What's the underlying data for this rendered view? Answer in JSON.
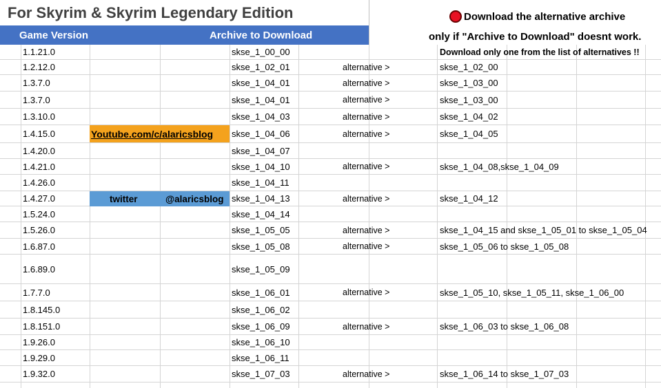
{
  "title": "For Skyrim & Skyrim Legendary Edition",
  "header": {
    "game_version": "Game Version",
    "archive": "Archive to Download"
  },
  "notes": {
    "line1": "Download the alternative archive",
    "line2": "only if \"Archive to Download\" doesnt work.",
    "line3": "Download only one from the list of alternatives !!",
    "stop_icon": "stop-sign-icon",
    "stop_color": "#e81123"
  },
  "links": {
    "youtube": "Youtube.com/c/alaricsblog",
    "twitter_label": "twitter",
    "twitter_handle": "@alaricsblog"
  },
  "colors": {
    "header": "#4472c4",
    "youtube": "#f4a21d",
    "twitter": "#5b9bd5"
  },
  "rows": [
    {
      "version": "1.1.21.0",
      "archive": "skse_1_00_00",
      "alt": "",
      "alternatives": ""
    },
    {
      "version": "1.2.12.0",
      "archive": "skse_1_02_01",
      "alt": "alternative >",
      "alternatives": "skse_1_02_00"
    },
    {
      "version": "1.3.7.0",
      "archive": "skse_1_04_01",
      "alt": "alternative >",
      "alternatives": "skse_1_03_00"
    },
    {
      "version": "1.3.7.0",
      "archive": "skse_1_04_01",
      "alt": "alternative >",
      "alternatives": "skse_1_03_00"
    },
    {
      "version": "1.3.10.0",
      "archive": "skse_1_04_03",
      "alt": "alternative >",
      "alternatives": "skse_1_04_02"
    },
    {
      "version": "1.4.15.0",
      "archive": "skse_1_04_06",
      "alt": "alternative >",
      "alternatives": "skse_1_04_05"
    },
    {
      "version": "1.4.20.0",
      "archive": "skse_1_04_07",
      "alt": "",
      "alternatives": ""
    },
    {
      "version": "1.4.21.0",
      "archive": "skse_1_04_10",
      "alt": "alternative >",
      "alternatives": "skse_1_04_08,skse_1_04_09"
    },
    {
      "version": "1.4.26.0",
      "archive": "skse_1_04_11",
      "alt": "",
      "alternatives": ""
    },
    {
      "version": "1.4.27.0",
      "archive": "skse_1_04_13",
      "alt": "alternative >",
      "alternatives": "skse_1_04_12"
    },
    {
      "version": "1.5.24.0",
      "archive": "skse_1_04_14",
      "alt": "",
      "alternatives": ""
    },
    {
      "version": "1.5.26.0",
      "archive": "skse_1_05_05",
      "alt": "alternative >",
      "alternatives": "skse_1_04_15 and skse_1_05_01 to skse_1_05_04"
    },
    {
      "version": "1.6.87.0",
      "archive": "skse_1_05_08",
      "alt": "alternative >",
      "alternatives": "skse_1_05_06 to skse_1_05_08"
    },
    {
      "version": "1.6.89.0",
      "archive": "skse_1_05_09",
      "alt": "",
      "alternatives": ""
    },
    {
      "version": "1.7.7.0",
      "archive": "skse_1_06_01",
      "alt": "alternative >",
      "alternatives": "skse_1_05_10, skse_1_05_11, skse_1_06_00"
    },
    {
      "version": "1.8.145.0",
      "archive": "skse_1_06_02",
      "alt": "",
      "alternatives": ""
    },
    {
      "version": "1.8.151.0",
      "archive": "skse_1_06_09",
      "alt": "alternative >",
      "alternatives": "skse_1_06_03 to skse_1_06_08"
    },
    {
      "version": "1.9.26.0",
      "archive": "skse_1_06_10",
      "alt": "",
      "alternatives": ""
    },
    {
      "version": "1.9.29.0",
      "archive": "skse_1_06_11",
      "alt": "",
      "alternatives": ""
    },
    {
      "version": "1.9.32.0",
      "archive": "skse_1_07_03",
      "alt": "alternative >",
      "alternatives": "skse_1_06_14 to skse_1_07_03"
    }
  ]
}
